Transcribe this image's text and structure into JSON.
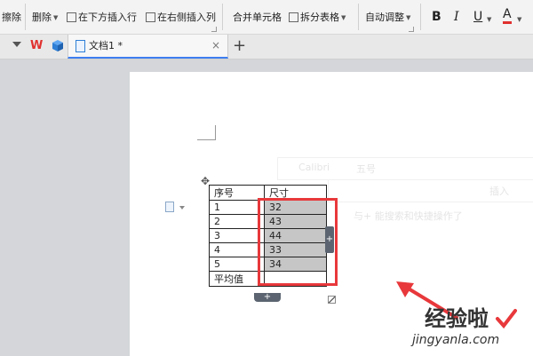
{
  "ribbon": {
    "erase_label": "擦除",
    "delete_label": "删除",
    "insert_below_label": "在下方插入行",
    "insert_right_label": "在右侧插入列",
    "merge_cells_label": "合并单元格",
    "split_table_label": "拆分表格",
    "auto_fit_label": "自动调整",
    "bold_label": "B",
    "italic_label": "I",
    "underline_label": "U",
    "font_color_label": "A"
  },
  "tabs": {
    "document_tab_label": "文档1 *",
    "new_tab_label": "+"
  },
  "ghost_toolbar": {
    "font_name": "Calibri",
    "font_size": "五号",
    "insert_label": "插入",
    "hint": "与+ 能搜索和快捷操作了"
  },
  "table": {
    "headers": [
      "序号",
      "尺寸"
    ],
    "rows": [
      [
        "1",
        "32"
      ],
      [
        "2",
        "43"
      ],
      [
        "3",
        "44"
      ],
      [
        "4",
        "33"
      ],
      [
        "5",
        "34"
      ],
      [
        "平均值",
        ""
      ]
    ]
  },
  "handles": {
    "add_column": "+",
    "add_row": "+"
  },
  "watermark": {
    "text": "经验啦",
    "url": "jingyanla.com"
  },
  "colors": {
    "highlight_box": "#e8383b",
    "arrow": "#e8383b",
    "selection": "#c6c6c6",
    "tab_accent": "#3c7ef0",
    "wps_logo": "#e0312f"
  }
}
